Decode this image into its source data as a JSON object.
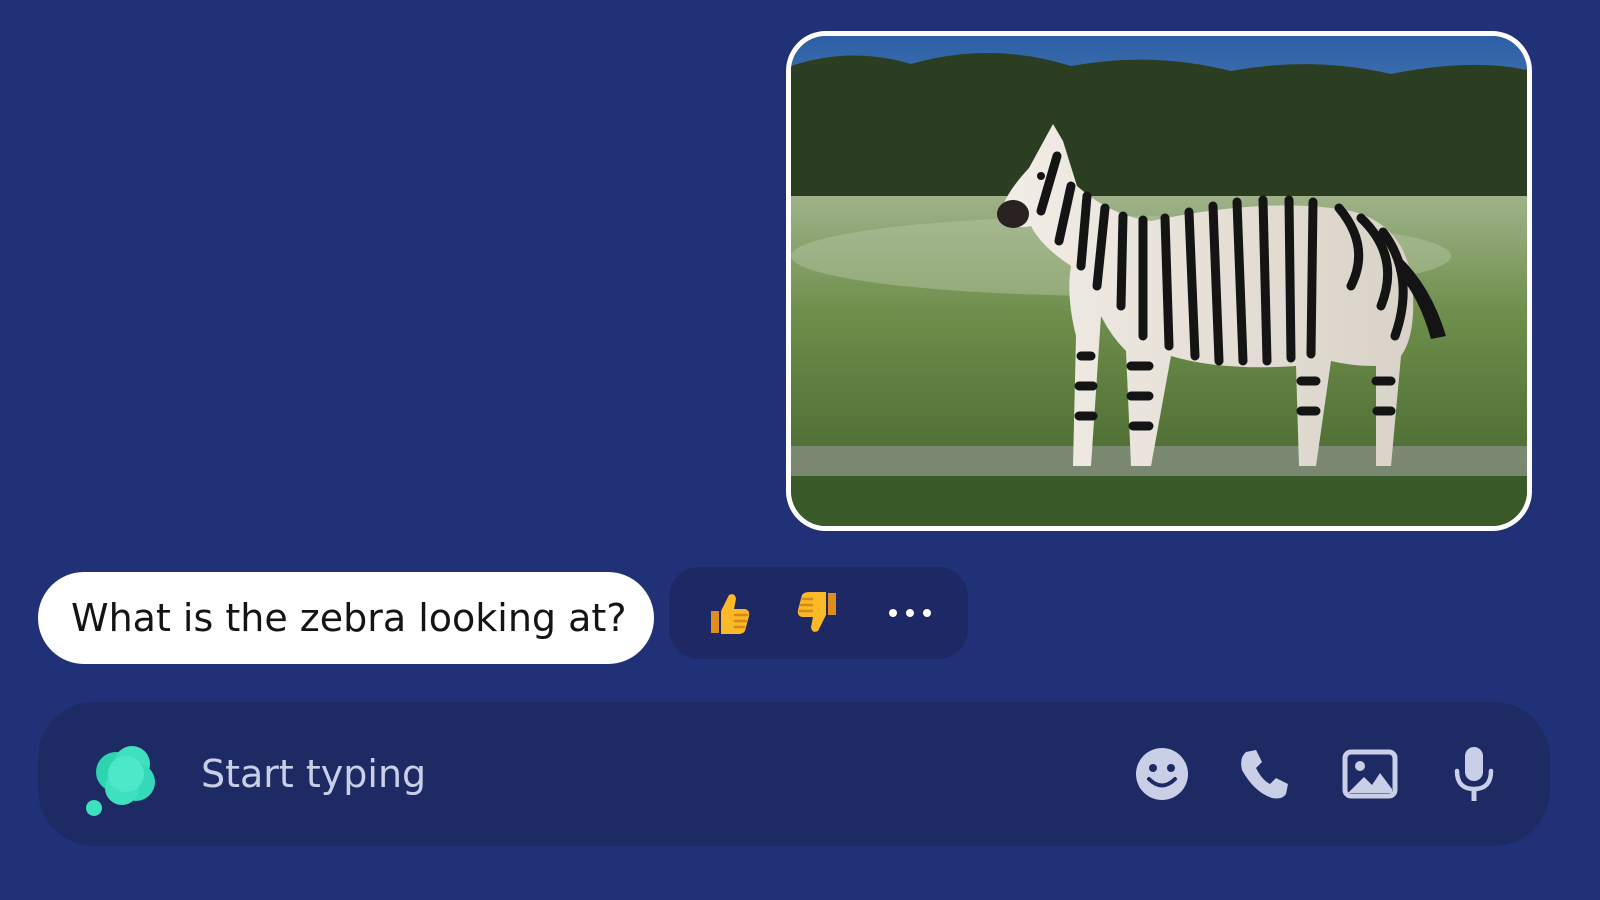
{
  "conversation": {
    "image_message": {
      "image_subject": "zebra standing on grassland"
    },
    "text_message": {
      "text": "What is the zebra looking at?"
    },
    "reactions": {
      "thumbs_up_icon": "thumbs-up-icon",
      "thumbs_down_icon": "thumbs-down-icon",
      "more_icon": "more-horizontal-icon"
    }
  },
  "composer": {
    "placeholder": "Start typing",
    "icons": [
      "emoji-icon",
      "phone-icon",
      "image-icon",
      "microphone-icon"
    ]
  },
  "colors": {
    "background": "#213177",
    "composer": "#1e2a63",
    "reaction_pill": "#1d2865",
    "bubble": "#ffffff",
    "accent": "#3fe0c0",
    "icon": "#c9cfe6"
  }
}
